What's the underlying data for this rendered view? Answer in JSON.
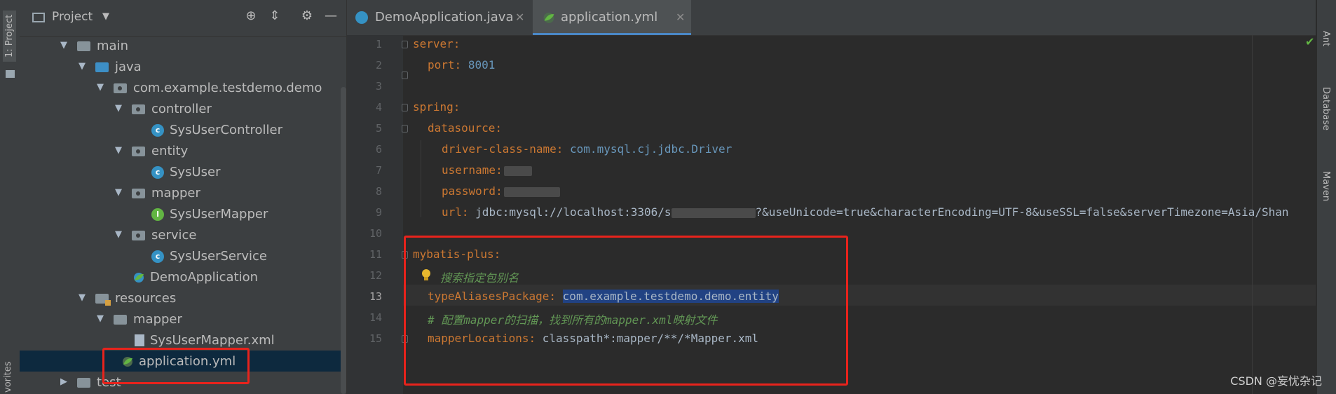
{
  "left_strip": {
    "project_tab": "1: Project",
    "favorites_tab": "vorites"
  },
  "project_panel": {
    "title": "Project",
    "tree": [
      {
        "label": "main",
        "kind": "folder"
      },
      {
        "label": "java",
        "kind": "source-folder"
      },
      {
        "label": "com.example.testdemo.demo",
        "kind": "package"
      },
      {
        "label": "controller",
        "kind": "package"
      },
      {
        "label": "SysUserController",
        "kind": "class"
      },
      {
        "label": "entity",
        "kind": "package"
      },
      {
        "label": "SysUser",
        "kind": "class"
      },
      {
        "label": "mapper",
        "kind": "package"
      },
      {
        "label": "SysUserMapper",
        "kind": "interface"
      },
      {
        "label": "service",
        "kind": "package"
      },
      {
        "label": "SysUserService",
        "kind": "class"
      },
      {
        "label": "DemoApplication",
        "kind": "spring-class"
      },
      {
        "label": "resources",
        "kind": "resources-folder"
      },
      {
        "label": "mapper",
        "kind": "folder"
      },
      {
        "label": "SysUserMapper.xml",
        "kind": "xml"
      },
      {
        "label": "application.yml",
        "kind": "yml"
      },
      {
        "label": "test",
        "kind": "folder"
      }
    ]
  },
  "tabs": [
    {
      "label": "DemoApplication.java",
      "active": false
    },
    {
      "label": "application.yml",
      "active": true
    }
  ],
  "editor": {
    "line_numbers": [
      "1",
      "2",
      "3",
      "4",
      "5",
      "6",
      "7",
      "8",
      "9",
      "10",
      "11",
      "12",
      "13",
      "14",
      "15"
    ],
    "current_line": "13",
    "lines": {
      "l1_key": "server:",
      "l2_key": "port:",
      "l2_val": "8001",
      "l4_key": "spring:",
      "l5_key": "datasource:",
      "l6_key": "driver-class-name:",
      "l6_val": "com.mysql.cj.jdbc.Driver",
      "l7_key": "username:",
      "l8_key": "password:",
      "l9_key": "url:",
      "l9_val_a": "jdbc:mysql://localhost:3306/s",
      "l9_val_b": "?&useUnicode=true&characterEncoding=UTF-8&useSSL=false&serverTimezone=Asia/Shan",
      "l11_key": "mybatis-plus:",
      "l12_comment": "搜索指定包别名",
      "l13_key": "typeAliasesPackage:",
      "l13_val": "com.example.testdemo.demo.entity",
      "l14_comment": "# 配置mapper的扫描，找到所有的mapper.xml映射文件",
      "l15_key": "mapperLocations:",
      "l15_val": "classpath*:mapper/**/*Mapper.xml"
    }
  },
  "right_strip": {
    "tabs": [
      "Ant",
      "Database",
      "Maven"
    ]
  },
  "watermark": "CSDN @妄忧杂记",
  "colors": {
    "keyword": "#cc7832",
    "number": "#6897bb",
    "comment": "#629755",
    "highlight_box": "#e8231c"
  }
}
